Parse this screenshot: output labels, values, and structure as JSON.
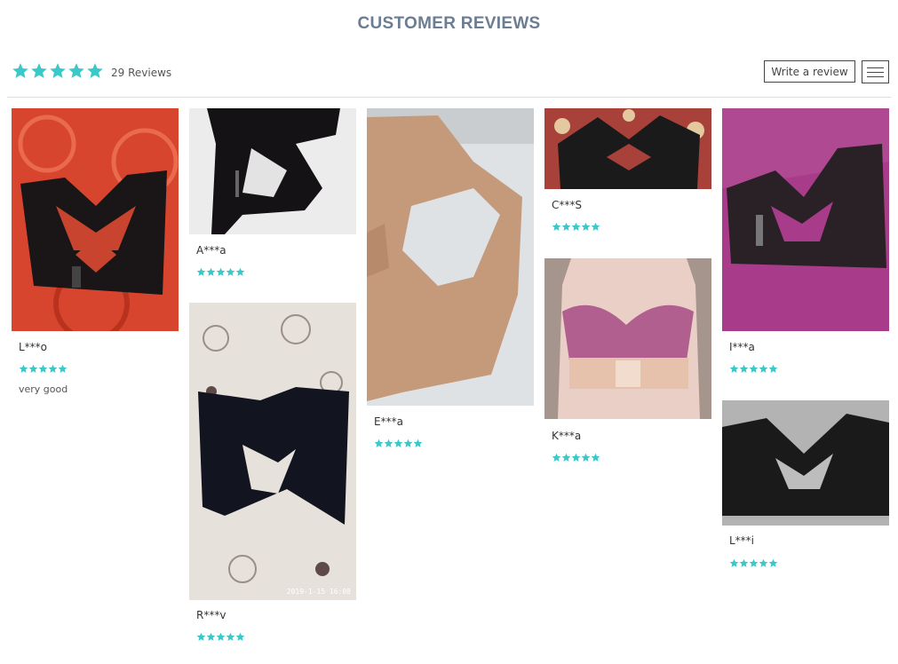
{
  "header": {
    "title": "CUSTOMER REVIEWS"
  },
  "summary": {
    "rating": 5,
    "count_label": "29 Reviews"
  },
  "actions": {
    "write_review": "Write a review"
  },
  "colors": {
    "star": "#3cc8c8",
    "title": "#6b7c93"
  },
  "reviews": [
    {
      "name": "L***o",
      "rating": 5,
      "text": "very good"
    },
    {
      "name": "A***a",
      "rating": 5
    },
    {
      "name": "R***v",
      "rating": 5,
      "photo_stamp": "2019-1-15 16:08"
    },
    {
      "name": "E***a",
      "rating": 5
    },
    {
      "name": "C***S",
      "rating": 5
    },
    {
      "name": "K***a",
      "rating": 5
    },
    {
      "name": "I***a",
      "rating": 5
    },
    {
      "name": "L***i",
      "rating": 5
    }
  ]
}
